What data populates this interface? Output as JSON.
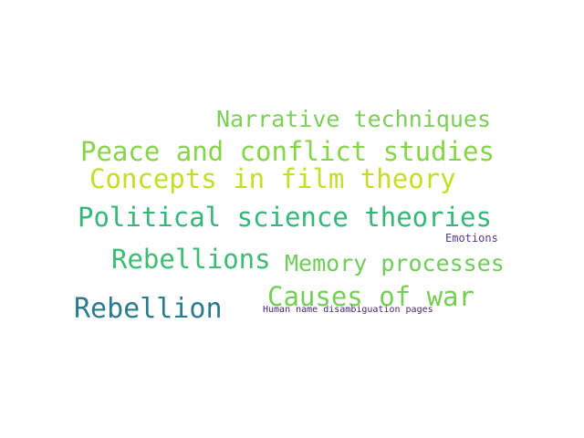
{
  "words": [
    {
      "text": "Narrative techniques",
      "color": "#7ccf59"
    },
    {
      "text": "Peace and conflict studies",
      "color": "#86d549"
    },
    {
      "text": "Concepts in film theory",
      "color": "#c2df23"
    },
    {
      "text": "Political science theories",
      "color": "#35b779"
    },
    {
      "text": "Emotions",
      "color": "#5b3c8f"
    },
    {
      "text": "Rebellions",
      "color": "#3dbc74"
    },
    {
      "text": "Memory processes",
      "color": "#6ece58"
    },
    {
      "text": "Causes of war",
      "color": "#74d055"
    },
    {
      "text": "Rebellion",
      "color": "#2a7b8e"
    },
    {
      "text": "Human name disambiguation pages",
      "color": "#482677"
    }
  ]
}
